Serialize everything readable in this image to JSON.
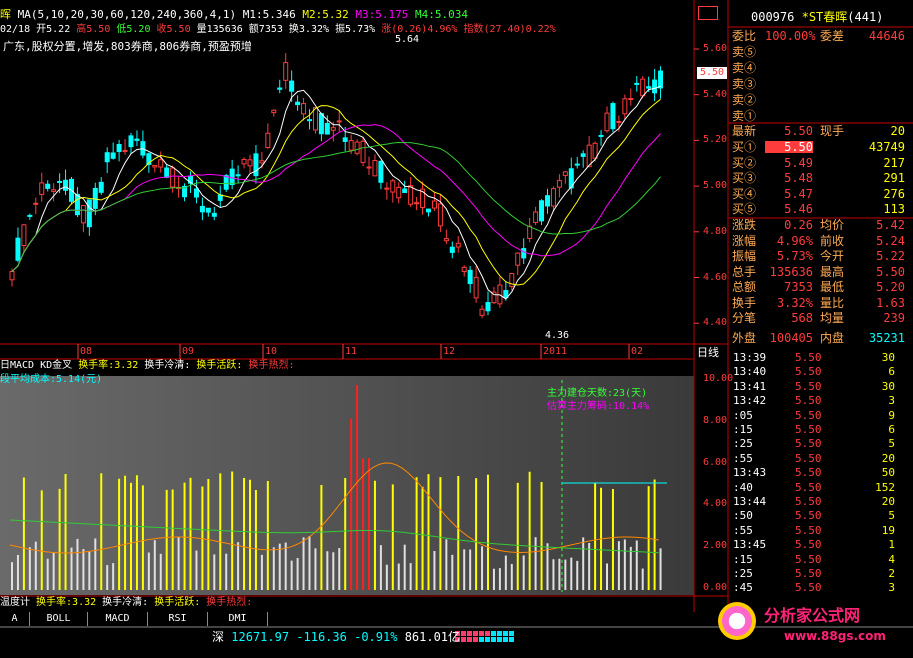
{
  "colors": {
    "up": "#ff3c3c",
    "down": "#00ffff",
    "ma1": "#ffffff",
    "ma2": "#ffff00",
    "ma3": "#ff00ff",
    "ma4": "#33cc33",
    "divider": "#c00000"
  },
  "top_bar": {
    "stock_short": "晖",
    "ma_text": "MA(5,10,20,30,60,120,240,360,4,1)",
    "m1": "M1:5.346",
    "m2": "M2:5.32",
    "m3": "M3:5.175",
    "m4": "M4:5.034",
    "date": "02/18",
    "open": "开5.22",
    "high": "高5.50",
    "low": "低5.20",
    "close": "收5.50",
    "vol": "量135636",
    "amt": "额7353",
    "turnover": "换3.32%",
    "amp": "振5.73%",
    "chg": "涨(0.26)4.96%",
    "idx": "指数(27.40)0.22%"
  },
  "announcement": "广东,股权分置,增发,803券商,806券商,预盈预增",
  "high_label": "5.64",
  "low_label": "4.36",
  "price_flag": "5.50",
  "price_axis": [
    "5.60",
    "5.40",
    "5.20",
    "5.00",
    "4.80",
    "4.60",
    "4.40"
  ],
  "date_labels": [
    "08",
    "09",
    "10",
    "11",
    "12",
    "2011",
    "02"
  ],
  "period": "日线",
  "sub_header": {
    "prefix": "日MACD KD金叉",
    "turnover": "换手率:3.32",
    "cold": "换手冷清:",
    "active": "换手活跃:",
    "hot": "换手热烈:"
  },
  "cost_label": "段平均成本:5.14(元)",
  "build_days": "主力建仓天数:23(天)",
  "chip_ratio": "估算主力筹码:10.14%",
  "vol_axis": [
    "10.00",
    "8.00",
    "6.00",
    "4.00",
    "2.00",
    "0.00"
  ],
  "sub2_header": {
    "prefix": "温度计",
    "turnover": "换手率:3.32",
    "cold": "换手冷清:",
    "active": "换手活跃:",
    "hot": "换手热烈:"
  },
  "tabs": [
    "A",
    "BOLL",
    "MACD",
    "RSI",
    "DMI"
  ],
  "status_bar": {
    "market": "深",
    "index": "12671.97",
    "chg": "-116.36",
    "pct": "-0.91%",
    "amount": "861.01亿"
  },
  "quote": {
    "code": "000976",
    "name": "*ST春晖",
    "num": "(441)",
    "ratio_label": "委比",
    "ratio_value": "100.00%",
    "diff_label": "委差",
    "diff_value": "44646",
    "sells": [
      "卖⑤",
      "卖④",
      "卖③",
      "卖②",
      "卖①"
    ],
    "last_label": "最新",
    "last_value": "5.50",
    "hand_label": "现手",
    "hand_value": "20",
    "buys": [
      {
        "label": "买①",
        "price": "5.50",
        "vol": "43749"
      },
      {
        "label": "买②",
        "price": "5.49",
        "vol": "217"
      },
      {
        "label": "买③",
        "price": "5.48",
        "vol": "291"
      },
      {
        "label": "买④",
        "price": "5.47",
        "vol": "276"
      },
      {
        "label": "买⑤",
        "price": "5.46",
        "vol": "113"
      }
    ],
    "stats": [
      {
        "l1": "涨跌",
        "v1": "0.26",
        "l2": "均价",
        "v2": "5.42"
      },
      {
        "l1": "涨幅",
        "v1": "4.96%",
        "l2": "前收",
        "v2": "5.24"
      },
      {
        "l1": "振幅",
        "v1": "5.73%",
        "l2": "今开",
        "v2": "5.22"
      },
      {
        "l1": "总手",
        "v1": "135636",
        "l2": "最高",
        "v2": "5.50"
      },
      {
        "l1": "总额",
        "v1": "7353",
        "l2": "最低",
        "v2": "5.20"
      },
      {
        "l1": "换手",
        "v1": "3.32%",
        "l2": "量比",
        "v2": "1.63"
      },
      {
        "l1": "分笔",
        "v1": "568",
        "l2": "均量",
        "v2": "239"
      }
    ],
    "outer_label": "外盘",
    "outer_value": "100405",
    "inner_label": "内盘",
    "inner_value": "35231"
  },
  "ticks": [
    {
      "t": "13:39",
      "p": "5.50",
      "v": "30"
    },
    {
      "t": "13:40",
      "p": "5.50",
      "v": "6"
    },
    {
      "t": "13:41",
      "p": "5.50",
      "v": "30"
    },
    {
      "t": "13:42",
      "p": "5.50",
      "v": "3"
    },
    {
      "t": ":05",
      "p": "5.50",
      "v": "9"
    },
    {
      "t": ":15",
      "p": "5.50",
      "v": "6"
    },
    {
      "t": ":25",
      "p": "5.50",
      "v": "5"
    },
    {
      "t": ":55",
      "p": "5.50",
      "v": "20"
    },
    {
      "t": "13:43",
      "p": "5.50",
      "v": "50"
    },
    {
      "t": ":40",
      "p": "5.50",
      "v": "152"
    },
    {
      "t": "13:44",
      "p": "5.50",
      "v": "20"
    },
    {
      "t": ":50",
      "p": "5.50",
      "v": "5"
    },
    {
      "t": ":55",
      "p": "5.50",
      "v": "19"
    },
    {
      "t": "13:45",
      "p": "5.50",
      "v": "1"
    },
    {
      "t": ":15",
      "p": "5.50",
      "v": "4"
    },
    {
      "t": ":25",
      "p": "5.50",
      "v": "2"
    },
    {
      "t": ":45",
      "p": "5.50",
      "v": "3"
    }
  ],
  "watermark": {
    "title": "分析家公式网",
    "url": "www.88gs.com"
  }
}
